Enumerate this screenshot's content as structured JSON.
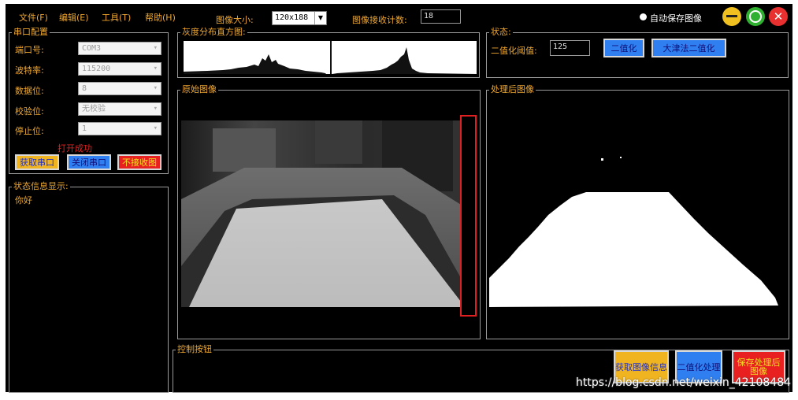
{
  "menu": {
    "file": "文件(F)",
    "edit": "编辑(E)",
    "tools": "工具(T)",
    "help": "帮助(H)"
  },
  "toolbar": {
    "image_size_label": "图像大小:",
    "image_size_value": "120x188",
    "recv_count_label": "图像接收计数:",
    "recv_count_value": "18",
    "auto_save_label": "自动保存图像"
  },
  "serial": {
    "title": "串口配置",
    "port_label": "端口号:",
    "port_value": "COM3",
    "baud_label": "波特率:",
    "baud_value": "115200",
    "data_label": "数据位:",
    "data_value": "8",
    "parity_label": "校验位:",
    "parity_value": "无校验",
    "stop_label": "停止位:",
    "stop_value": "1",
    "status_text": "打开成功",
    "get_port": "获取串口",
    "close_port": "关闭串口",
    "no_recv": "不接收图"
  },
  "status_info": {
    "title": "状态信息显示:",
    "text": "你好"
  },
  "histogram": {
    "title": "灰度分布直方图:"
  },
  "state": {
    "title": "状态:",
    "threshold_label": "二值化阈值:",
    "threshold_value": "125",
    "binarize": "二值化",
    "otsu": "大津法二值化"
  },
  "original": {
    "title": "原始图像"
  },
  "processed": {
    "title": "处理后图像"
  },
  "control": {
    "title": "控制按钮",
    "get_info": "获取图像信息",
    "binarize_proc": "二值化处理",
    "save_proc": "保存处理后图像"
  },
  "watermark": "https://blog.csdn.net/weixin_42108484",
  "colors": {
    "accent": "#f0a830",
    "background": "#000000",
    "border": "#9a9a9a"
  }
}
